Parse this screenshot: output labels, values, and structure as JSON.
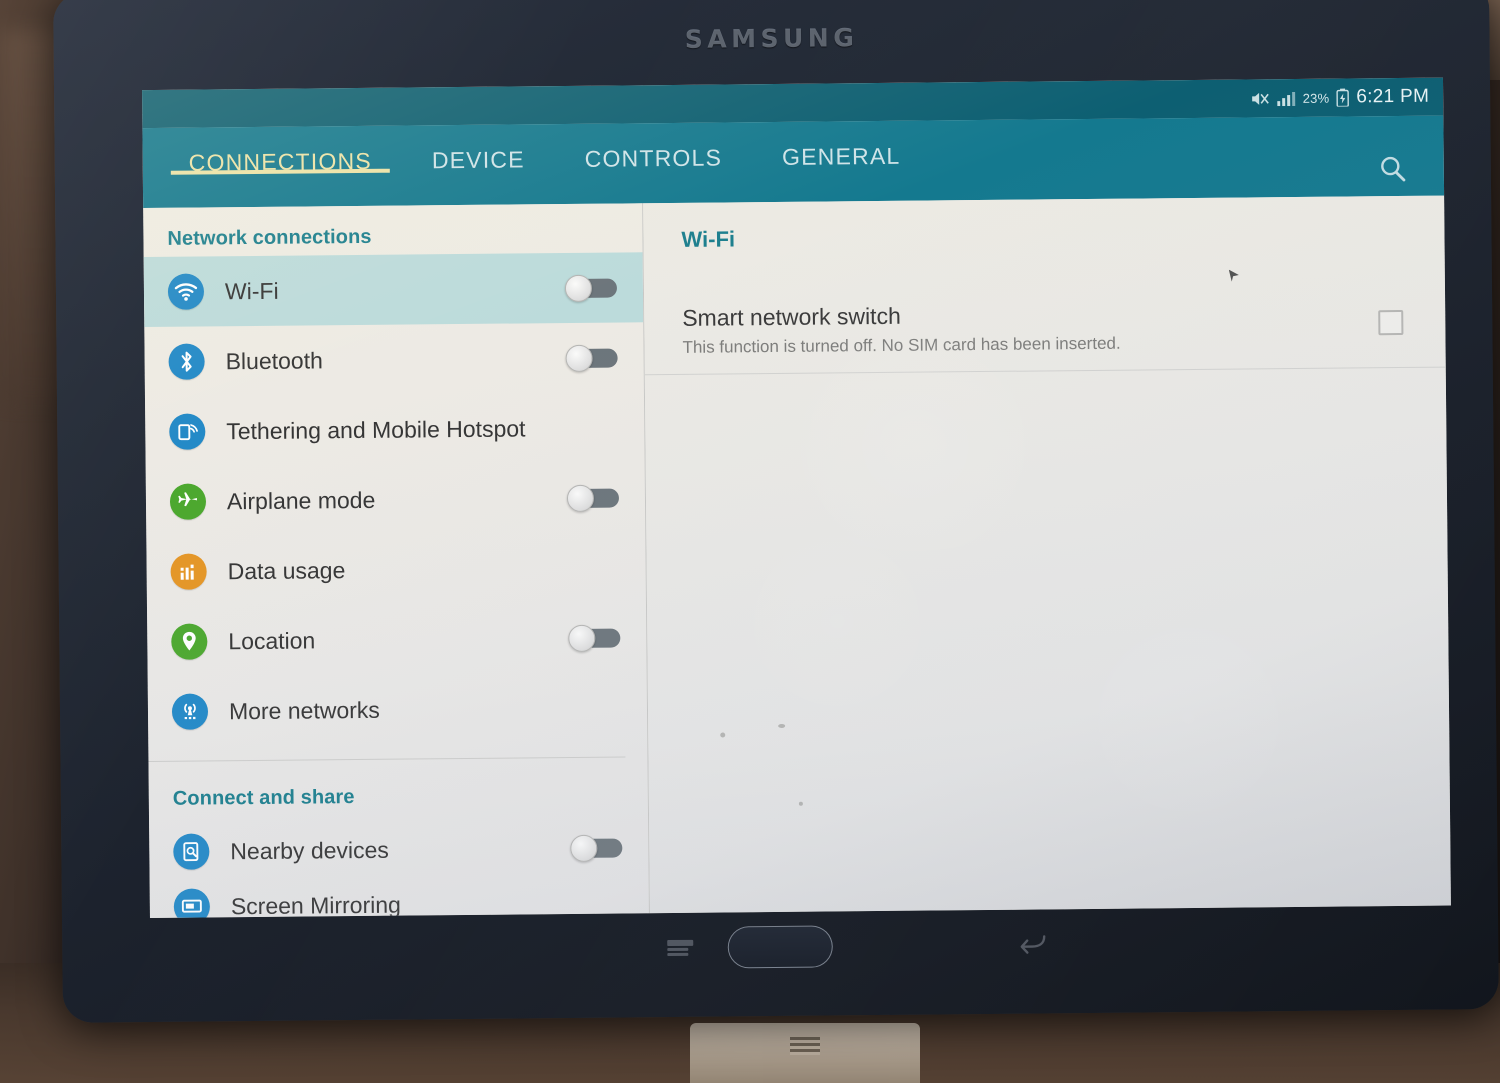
{
  "device": {
    "brand": "SAMSUNG",
    "hardware_keys": [
      "recent-apps",
      "home",
      "back"
    ]
  },
  "statusbar": {
    "mute_icon": "mute-icon",
    "signal_icon": "signal-bars-icon",
    "battery_percent": "23%",
    "battery_icon": "battery-icon",
    "time": "6:21 PM"
  },
  "appbar": {
    "tabs": [
      {
        "label": "CONNECTIONS",
        "active": true
      },
      {
        "label": "DEVICE",
        "active": false
      },
      {
        "label": "CONTROLS",
        "active": false
      },
      {
        "label": "GENERAL",
        "active": false
      }
    ],
    "search_icon": "search-icon",
    "accent_color": "#14798f",
    "active_tab_color": "#ece3a8"
  },
  "sidebar": {
    "sections": [
      {
        "title": "Network connections",
        "items": [
          {
            "label": "Wi-Fi",
            "icon": "wifi-icon",
            "icon_color": "#2289c7",
            "toggle": "off",
            "selected": true
          },
          {
            "label": "Bluetooth",
            "icon": "bluetooth-icon",
            "icon_color": "#2289c7",
            "toggle": "off",
            "selected": false
          },
          {
            "label": "Tethering and Mobile Hotspot",
            "icon": "tethering-icon",
            "icon_color": "#2289c7",
            "toggle": null,
            "selected": false
          },
          {
            "label": "Airplane mode",
            "icon": "airplane-icon",
            "icon_color": "#4ca82e",
            "toggle": "off",
            "selected": false
          },
          {
            "label": "Data usage",
            "icon": "data-usage-icon",
            "icon_color": "#e59626",
            "toggle": null,
            "selected": false
          },
          {
            "label": "Location",
            "icon": "location-pin-icon",
            "icon_color": "#4ca82e",
            "toggle": "off",
            "selected": false
          },
          {
            "label": "More networks",
            "icon": "more-networks-icon",
            "icon_color": "#2289c7",
            "toggle": null,
            "selected": false
          }
        ]
      },
      {
        "title": "Connect and share",
        "items": [
          {
            "label": "Nearby devices",
            "icon": "nearby-devices-icon",
            "icon_color": "#2289c7",
            "toggle": "off",
            "selected": false
          },
          {
            "label": "Screen Mirroring",
            "icon": "screen-mirroring-icon",
            "icon_color": "#2289c7",
            "toggle": null,
            "selected": false
          }
        ]
      }
    ],
    "section_title_color": "#1c7f8e",
    "selected_row_color": "#bcdbdb"
  },
  "content": {
    "title": "Wi-Fi",
    "preference": {
      "title": "Smart network switch",
      "subtitle": "This function is turned off. No SIM card has been inserted.",
      "checkbox": "unchecked"
    }
  }
}
